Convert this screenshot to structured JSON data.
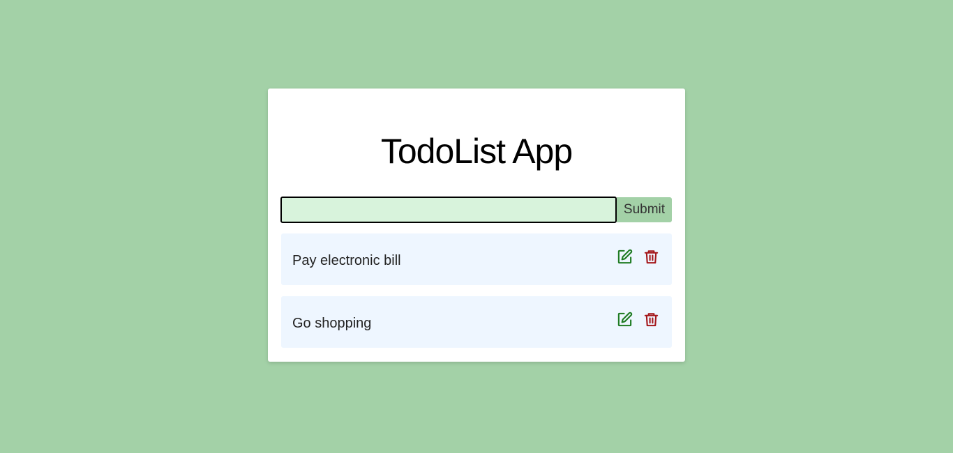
{
  "app": {
    "title": "TodoList App"
  },
  "form": {
    "input_value": "",
    "input_placeholder": "",
    "submit_label": "Submit"
  },
  "todos": [
    {
      "text": "Pay electronic bill",
      "edit_icon": "edit-icon",
      "delete_icon": "trash-icon"
    },
    {
      "text": "Go shopping",
      "edit_icon": "edit-icon",
      "delete_icon": "trash-icon"
    }
  ],
  "colors": {
    "background": "#a3d1a7",
    "input_bg": "#d8f3dc",
    "item_bg": "#eef6ff",
    "edit_icon": "#1e7b22",
    "delete_icon": "#a4161a"
  }
}
